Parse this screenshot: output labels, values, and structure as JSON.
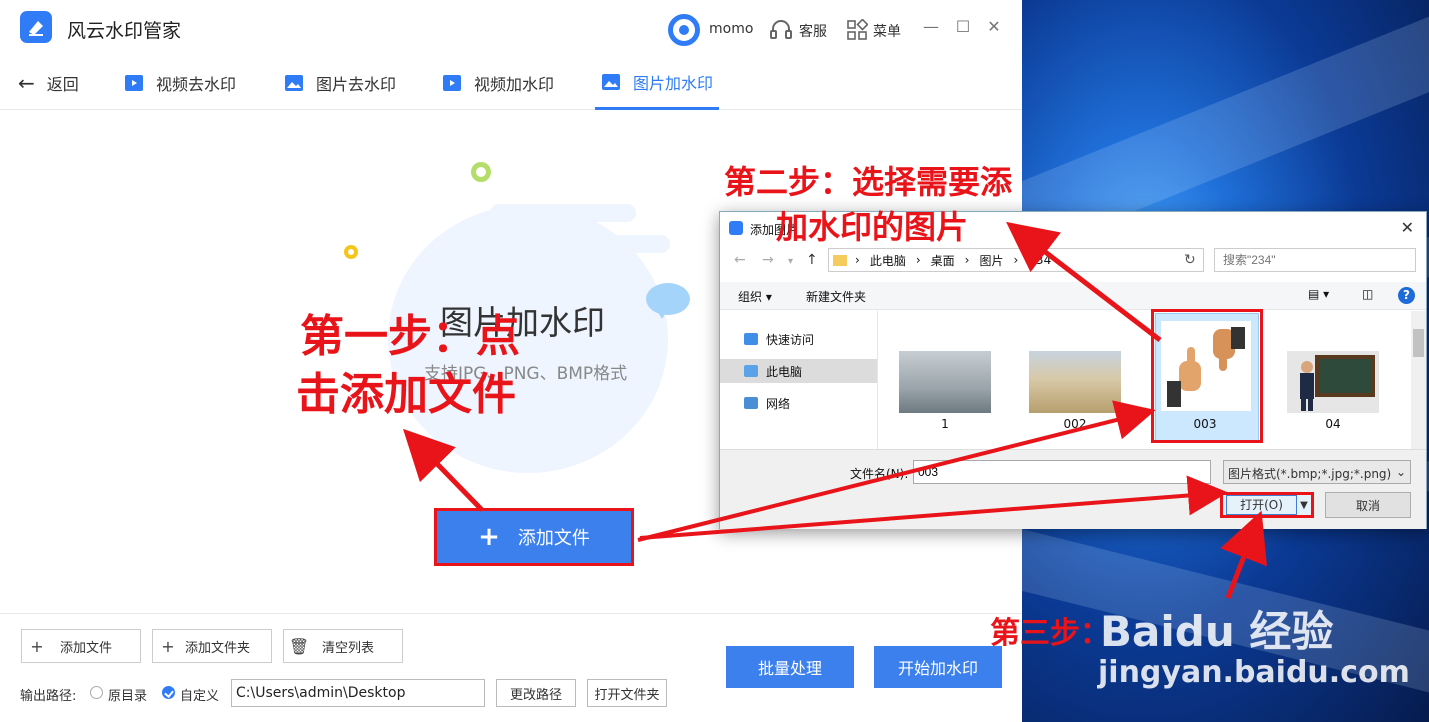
{
  "app": {
    "title": "风云水印管家",
    "user": "momo",
    "service_label": "客服",
    "menu_label": "菜单"
  },
  "nav": {
    "back_label": "返回",
    "tabs": [
      {
        "label": "视频去水印",
        "icon": "video-icon"
      },
      {
        "label": "图片去水印",
        "icon": "image-icon"
      },
      {
        "label": "视频加水印",
        "icon": "video-icon"
      },
      {
        "label": "图片加水印",
        "icon": "image-icon",
        "active": true
      }
    ]
  },
  "main": {
    "heading": "图片加水印",
    "subtitle": "支持JPG、PNG、BMP格式",
    "add_file_button": "添加文件"
  },
  "toolbar": {
    "add_file": "添加文件",
    "add_folder": "添加文件夹",
    "clear_list": "清空列表",
    "output_label": "输出路径:",
    "opt_original": "原目录",
    "opt_custom": "自定义",
    "output_path": "C:\\Users\\admin\\Desktop",
    "change_path": "更改路径",
    "open_folder": "打开文件夹",
    "batch": "批量处理",
    "start": "开始加水印"
  },
  "dialog": {
    "title": "添加图片",
    "breadcrumb": [
      "此电脑",
      "桌面",
      "图片",
      "234"
    ],
    "search_placeholder": "搜索\"234\"",
    "organize": "组织 ▾",
    "new_folder": "新建文件夹",
    "nav_items": [
      "快速访问",
      "此电脑",
      "网络"
    ],
    "files": [
      "1",
      "002",
      "003",
      "04"
    ],
    "file_name_label": "文件名(N):",
    "file_name_value": "003",
    "file_type": "图片格式(*.bmp;*.jpg;*.png)",
    "open": "打开(O)",
    "cancel": "取消"
  },
  "annotations": {
    "step1_line1": "第一步：点",
    "step1_line2": "击添加文件",
    "step2_line1": "第二步：选择需要添",
    "step2_line2": "加水印的图片",
    "step3": "第三步："
  },
  "watermark": {
    "brand": "Baidu 经验",
    "url": "jingyan.baidu.com"
  },
  "colors": {
    "accent": "#2f7cf6",
    "annotation": "#e8141a"
  }
}
